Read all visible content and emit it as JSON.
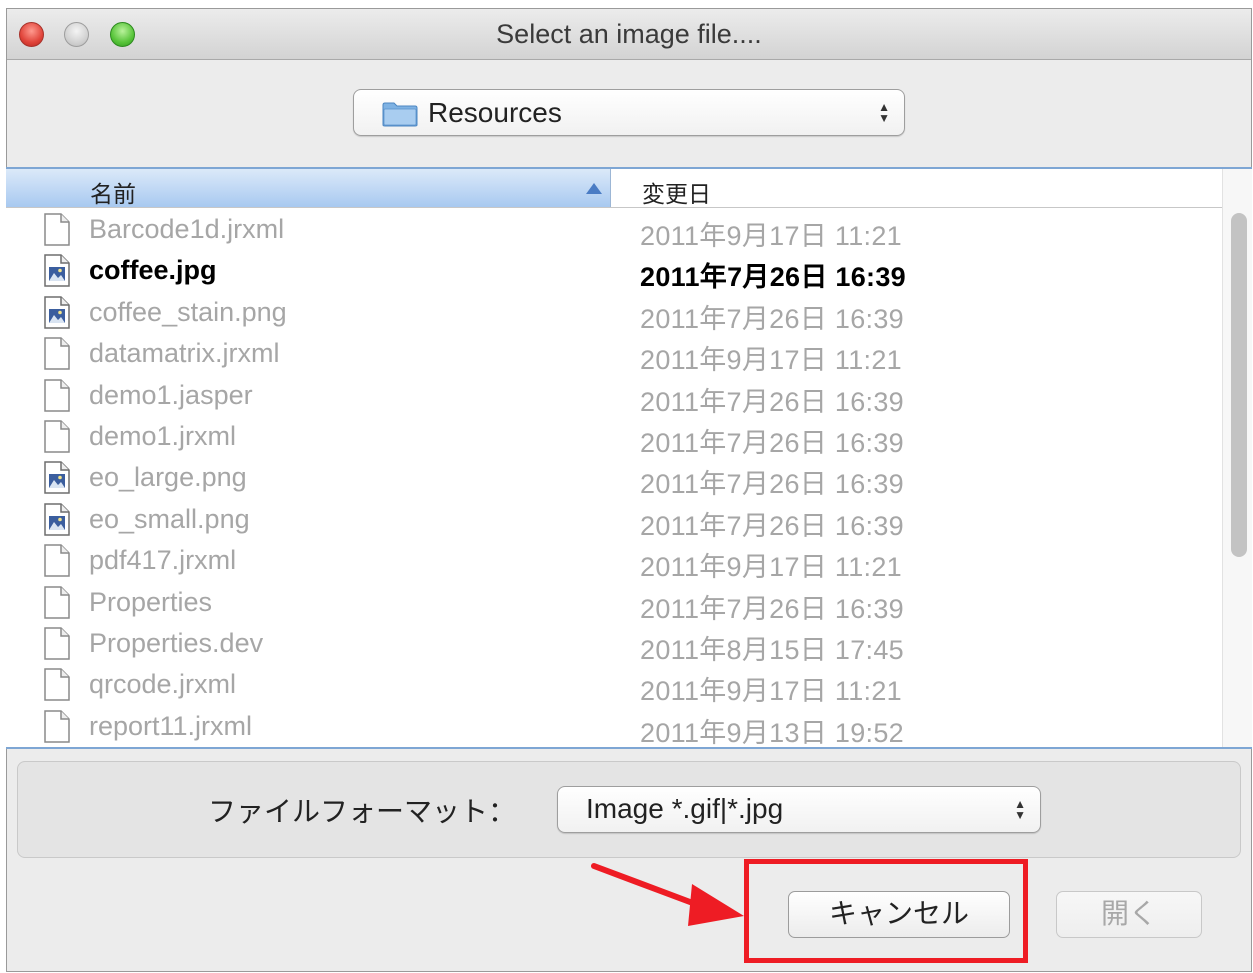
{
  "window": {
    "title": "Select an image file...."
  },
  "location": {
    "label": "Resources"
  },
  "columns": {
    "name": "名前",
    "date": "変更日"
  },
  "files": [
    {
      "name": "Barcode1d.jrxml",
      "date": "2011年9月17日 11:21",
      "type": "doc",
      "enabled": false
    },
    {
      "name": "coffee.jpg",
      "date": "2011年7月26日 16:39",
      "type": "image",
      "enabled": true
    },
    {
      "name": "coffee_stain.png",
      "date": "2011年7月26日 16:39",
      "type": "image",
      "enabled": false
    },
    {
      "name": "datamatrix.jrxml",
      "date": "2011年9月17日 11:21",
      "type": "doc",
      "enabled": false
    },
    {
      "name": "demo1.jasper",
      "date": "2011年7月26日 16:39",
      "type": "doc",
      "enabled": false
    },
    {
      "name": "demo1.jrxml",
      "date": "2011年7月26日 16:39",
      "type": "doc",
      "enabled": false
    },
    {
      "name": "eo_large.png",
      "date": "2011年7月26日 16:39",
      "type": "image",
      "enabled": false
    },
    {
      "name": "eo_small.png",
      "date": "2011年7月26日 16:39",
      "type": "image",
      "enabled": false
    },
    {
      "name": "pdf417.jrxml",
      "date": "2011年9月17日 11:21",
      "type": "doc",
      "enabled": false
    },
    {
      "name": "Properties",
      "date": "2011年7月26日 16:39",
      "type": "doc",
      "enabled": false
    },
    {
      "name": "Properties.dev",
      "date": "2011年8月15日 17:45",
      "type": "doc",
      "enabled": false
    },
    {
      "name": "qrcode.jrxml",
      "date": "2011年9月17日 11:21",
      "type": "doc",
      "enabled": false
    },
    {
      "name": "report11.jrxml",
      "date": "2011年9月13日 19:52",
      "type": "doc",
      "enabled": false
    }
  ],
  "format": {
    "label": "ファイルフォーマット：",
    "value": "Image *.gif|*.jpg"
  },
  "buttons": {
    "cancel": "キャンセル",
    "open": "開く"
  },
  "annotation": {
    "color": "#ee1c24"
  }
}
